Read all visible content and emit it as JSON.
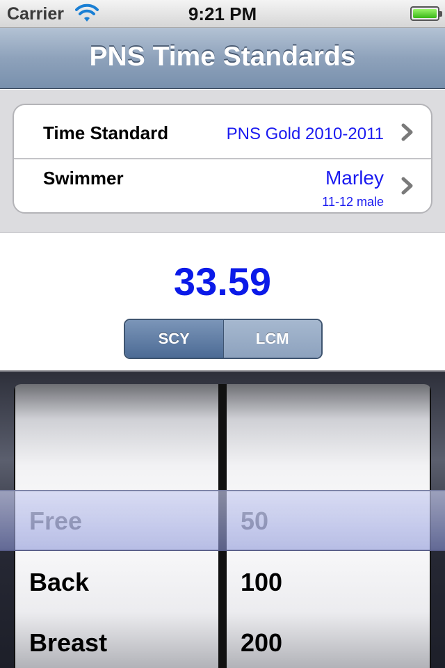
{
  "status_bar": {
    "carrier": "Carrier",
    "time": "9:21 PM",
    "wifi_icon": "wifi-icon",
    "battery_icon": "battery-icon",
    "battery_color": "#39b817"
  },
  "nav": {
    "title": "PNS Time Standards"
  },
  "table": {
    "rows": [
      {
        "label": "Time Standard",
        "value": "PNS Gold 2010-2011",
        "icon": "chevron-right-icon"
      },
      {
        "label": "Swimmer",
        "value": "Marley",
        "detail": "11-12 male",
        "icon": "chevron-right-icon"
      }
    ]
  },
  "result": {
    "time": "33.59",
    "color": "#0b1ae8"
  },
  "course_segment": {
    "options": [
      "SCY",
      "LCM"
    ],
    "selected": "SCY"
  },
  "picker": {
    "strokes": [
      "Free",
      "Back",
      "Breast"
    ],
    "distances": [
      "50",
      "100",
      "200"
    ],
    "selected_stroke": "Free",
    "selected_distance": "50"
  }
}
